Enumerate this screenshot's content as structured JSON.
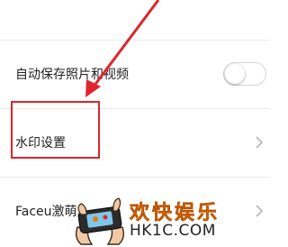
{
  "settings": {
    "items": [
      {
        "label": "自动保存照片和视频",
        "control": "toggle",
        "toggle_on": false
      },
      {
        "label": "水印设置",
        "control": "chevron",
        "chevron_glyph": "›"
      },
      {
        "label": "Faceu激萌",
        "control": "chevron",
        "chevron_glyph": "›"
      }
    ]
  },
  "annotation": {
    "arrow_color": "#e0242b",
    "box_color": "#e0242b"
  },
  "watermark": {
    "title": "欢快娱乐",
    "url": "HK1C.COM",
    "icon": "game-controller-hands-icon"
  },
  "colors": {
    "background": "#ffffff",
    "divider": "#ececec",
    "text": "#222222",
    "watermark_title": "#f07a12"
  }
}
